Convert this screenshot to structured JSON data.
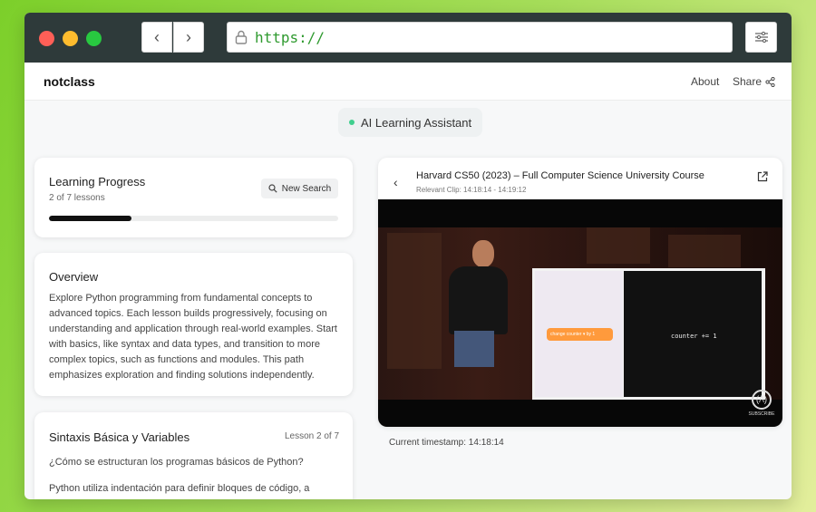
{
  "browser": {
    "url": "https://",
    "back_glyph": "‹",
    "forward_glyph": "›",
    "icons": [
      "lock-icon",
      "sliders-icon",
      "share-icon",
      "search-icon",
      "external-link-icon",
      "chevron-left-icon"
    ]
  },
  "header": {
    "brand": "notclass",
    "about": "About",
    "share": "Share"
  },
  "assistant": {
    "label": "AI Learning Assistant",
    "status_color": "#3fcf8e"
  },
  "progress": {
    "title": "Learning Progress",
    "subtitle": "2 of 7 lessons",
    "new_search": "New Search",
    "completed": 2,
    "total": 7
  },
  "overview": {
    "title": "Overview",
    "body": "Explore Python programming from fundamental concepts to advanced topics. Each lesson builds progressively, focusing on understanding and application through real-world examples. Start with basics, like syntax and data types, and transition to more complex topics, such as functions and modules. This path emphasizes exploration and finding solutions independently."
  },
  "lesson": {
    "title": "Sintaxis Básica y Variables",
    "badge": "Lesson 2 of 7",
    "question": "¿Cómo se estructuran los programas básicos de Python?",
    "paragraph": "Python utiliza indentación para definir bloques de código, a"
  },
  "video": {
    "back_glyph": "‹",
    "title": "Harvard CS50 (2023) – Full Computer Science University Course",
    "clip": "Relevant Clip: 14:18:14 - 14:19:12",
    "code_text": "counter += 1",
    "block_text": "change counter ▾ by 1",
    "subscribe_glyph": "(/\\)",
    "subscribe_label": "SUBSCRIBE",
    "timestamp": "Current timestamp: 14:18:14"
  },
  "colors": {
    "accent_green": "#2f9a2f",
    "progress_fill": "#111111"
  }
}
